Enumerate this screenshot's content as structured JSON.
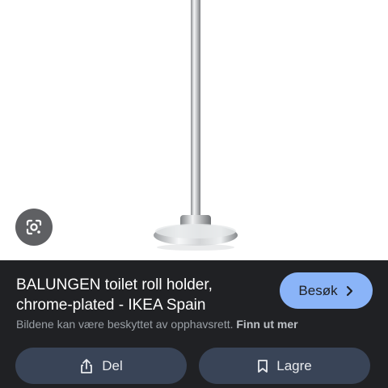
{
  "result": {
    "title": "BALUNGEN toilet roll holder, chrome-plated - IKEA Spain",
    "visit_label": "Besøk",
    "copyright_text": "Bildene kan være beskyttet av opphavsrett.",
    "learn_more_label": "Finn ut mer"
  },
  "actions": {
    "share_label": "Del",
    "save_label": "Lagre"
  },
  "icons": {
    "lens": "google-lens-icon",
    "visit": "chevron-right-icon",
    "share": "share-icon",
    "save": "bookmark-icon"
  },
  "colors": {
    "panel_bg": "#202124",
    "visit_button": "#8ab4f8",
    "action_button": "#394457",
    "secondary_text": "#9aa0a6"
  }
}
